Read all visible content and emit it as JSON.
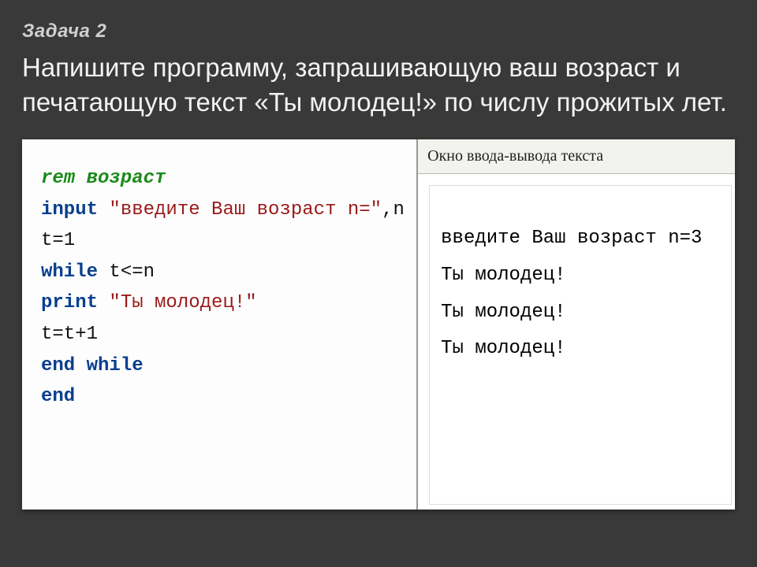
{
  "heading": "Задача 2",
  "task": "Напишите программу, запрашивающую ваш возраст и печатающую текст «Ты молодец!» по числу прожитых лет.",
  "code": {
    "l1_kw": "rem",
    "l1_rest": " возраст",
    "l2_kw": "input",
    "l2_str": " \"введите Ваш возраст n=\"",
    "l2_rest": ",n",
    "l3": "t=1",
    "l4_kw": "while",
    "l4_rest": " t<=n",
    "l5_kw": "print",
    "l5_str": " \"Ты молодец!\"",
    "l6": "t=t+1",
    "l7_kw": "end while",
    "l8_kw": "end"
  },
  "output": {
    "title": "Окно ввода-вывода текста",
    "lines": {
      "o1": "введите Ваш возраст n=3",
      "o2": "Ты молодец!",
      "o3": "Ты молодец!",
      "o4": "Ты молодец!"
    }
  }
}
